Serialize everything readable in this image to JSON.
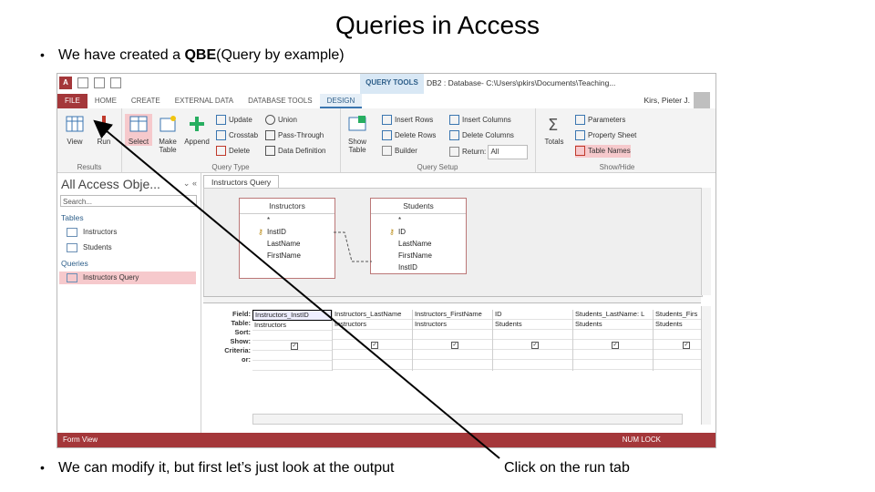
{
  "slide": {
    "title": "Queries in Access",
    "bullet1_pre": "We have created a ",
    "bullet1_bold": "QBE",
    "bullet1_post": "(Query by example)",
    "bullet2": "We can modify it, but first let’s just look at the output",
    "callout": "Click on the run tab",
    "bullet_glyph": "•"
  },
  "window": {
    "app_icon": "A",
    "context_tab": "QUERY TOOLS",
    "title": "DB2 : Database- C:\\Users\\pkirs\\Documents\\Teaching...",
    "user": "Kirs, Pieter J.",
    "tabs": [
      "FILE",
      "HOME",
      "CREATE",
      "EXTERNAL DATA",
      "DATABASE TOOLS",
      "DESIGN"
    ]
  },
  "ribbon": {
    "results": {
      "label": "Results",
      "view": "View",
      "run": "Run"
    },
    "query_type": {
      "label": "Query Type",
      "select": "Select",
      "make_table": "Make Table",
      "append": "Append",
      "update": "Update",
      "crosstab": "Crosstab",
      "delete": "Delete",
      "union": "Union",
      "pass_through": "Pass-Through",
      "data_definition": "Data Definition"
    },
    "query_setup": {
      "label": "Query Setup",
      "show_table": "Show Table",
      "insert_rows": "Insert Rows",
      "delete_rows": "Delete Rows",
      "builder": "Builder",
      "insert_columns": "Insert Columns",
      "delete_columns": "Delete Columns",
      "return_label": "Return:",
      "return_value": "All"
    },
    "show_hide": {
      "label": "Show/Hide",
      "totals": "Totals",
      "parameters": "Parameters",
      "property_sheet": "Property Sheet",
      "table_names": "Table Names"
    }
  },
  "nav": {
    "title": "All Access Obje...",
    "search_placeholder": "Search...",
    "tables_header": "Tables",
    "tables": [
      "Instructors",
      "Students"
    ],
    "queries_header": "Queries",
    "queries": [
      "Instructors Query"
    ]
  },
  "document_tab": "Instructors Query",
  "design": {
    "tables": [
      {
        "name": "Instructors",
        "fields": [
          "*",
          "InstID",
          "LastName",
          "FirstName"
        ],
        "key": "InstID"
      },
      {
        "name": "Students",
        "fields": [
          "*",
          "ID",
          "LastName",
          "FirstName",
          "InstID"
        ],
        "key": "ID"
      }
    ]
  },
  "grid": {
    "row_labels": [
      "Field:",
      "Table:",
      "Sort:",
      "Show:",
      "Criteria:",
      "or:"
    ],
    "columns": [
      {
        "field": "Instructors_InstID",
        "table": "Instructors",
        "show": true
      },
      {
        "field": "Instructors_LastName",
        "table": "Instructors",
        "show": true
      },
      {
        "field": "Instructors_FirstName",
        "table": "Instructors",
        "show": true
      },
      {
        "field": "ID",
        "table": "Students",
        "show": true
      },
      {
        "field": "Students_LastName: L",
        "table": "Students",
        "show": true
      },
      {
        "field": "Students_Firs",
        "table": "Students",
        "show": true
      }
    ]
  },
  "status": {
    "left": "Form View",
    "right": "NUM LOCK"
  }
}
